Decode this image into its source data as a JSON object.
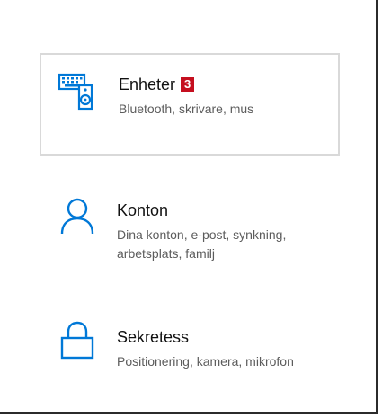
{
  "settings": {
    "items": [
      {
        "title": "Enheter",
        "badge": "3",
        "description": "Bluetooth, skrivare, mus",
        "icon": "devices-icon"
      },
      {
        "title": "Konton",
        "description_line1": "Dina konton, e-post, synkning,",
        "description_line2": "arbetsplats, familj",
        "icon": "person-icon"
      },
      {
        "title": "Sekretess",
        "description": "Positionering, kamera, mikrofon",
        "icon": "lock-icon"
      }
    ]
  },
  "colors": {
    "accent": "#0078d7",
    "badge": "#c50f1f",
    "title_text": "#111111",
    "description_text": "#5c5c5c",
    "selected_border": "#d9d9d9"
  }
}
